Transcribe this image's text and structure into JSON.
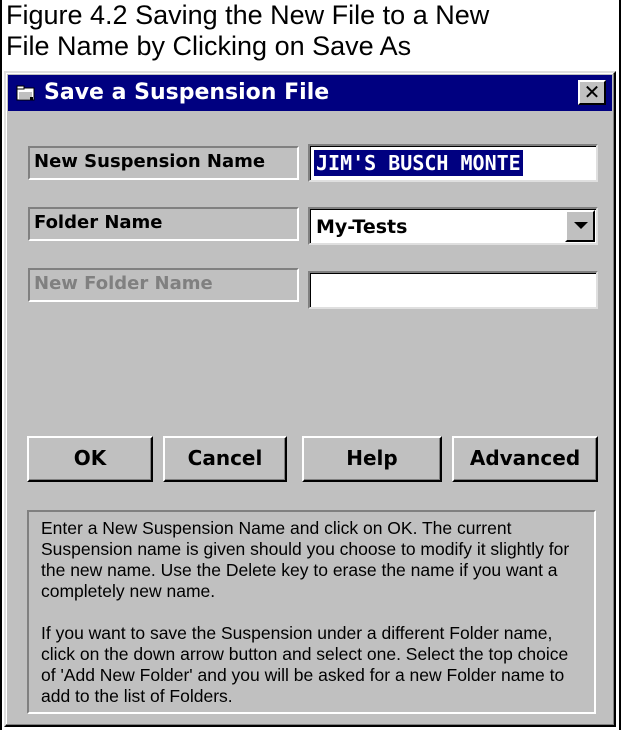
{
  "caption": {
    "line1": "Figure 4.2  Saving the New File to a New",
    "line2": "File Name by Clicking on Save As"
  },
  "dialog": {
    "title": "Save a Suspension File",
    "title_icon": "folder-icon",
    "close_icon": "close-icon",
    "close_glyph": "✕"
  },
  "fields": {
    "suspension_name_label": "New Suspension Name",
    "suspension_name_value": "JIM'S BUSCH MONTE",
    "folder_name_label": "Folder Name",
    "folder_name_value": "My-Tests",
    "folder_dropdown_icon": "chevron-down-icon",
    "new_folder_label": "New Folder Name",
    "new_folder_value": ""
  },
  "buttons": {
    "ok": "OK",
    "cancel": "Cancel",
    "help": "Help",
    "advanced": "Advanced"
  },
  "help_text": {
    "paragraph1": "Enter a New Suspension Name and click on OK.  The current Suspension name is given should you choose to modify it slightly for the new name.  Use the Delete key to erase the name if you want a completely new name.",
    "paragraph2": "If you want to save the Suspension under a different Folder name, click on the down arrow button and select one.  Select the top choice of 'Add New Folder' and you will be asked for a new Folder name to add to the list of Folders."
  },
  "colors": {
    "titlebar": "#000080",
    "face": "#c0c0c0",
    "selection": "#000080"
  }
}
